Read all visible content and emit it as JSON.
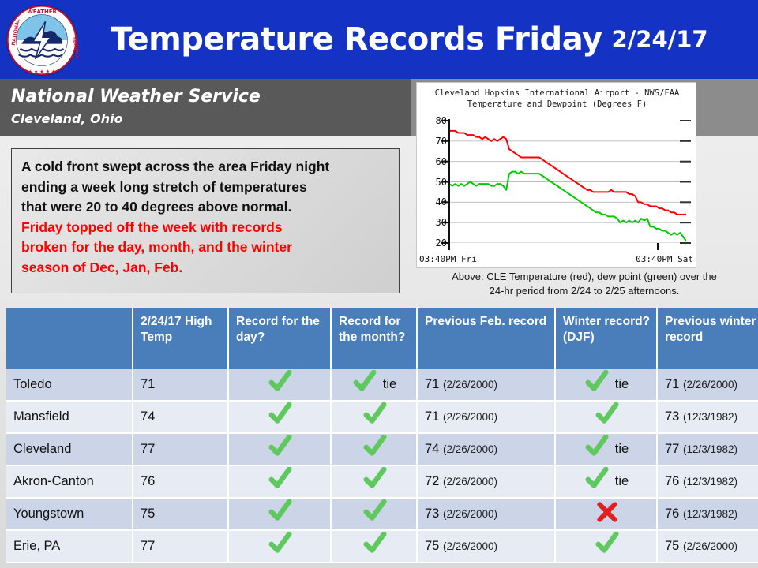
{
  "header": {
    "title": "Temperature Records Friday",
    "date": "2/24/17",
    "bg_color": "#1433c4",
    "logo_icon": "nws-seal-icon"
  },
  "office": {
    "name": "National Weather Service",
    "location": "Cleveland, Ohio",
    "bg_color": "#595959"
  },
  "summary": {
    "lines": [
      {
        "text": "A cold front swept across the area Friday night",
        "color": "#111111"
      },
      {
        "text": "ending a week long stretch of temperatures",
        "color": "#111111"
      },
      {
        "text": "that were 20 to 40 degrees above normal.",
        "color": "#111111"
      },
      {
        "text": "Friday topped off the week with records",
        "color": "#ff0000"
      },
      {
        "text": "broken for the day, month, and the winter",
        "color": "#ff0000"
      },
      {
        "text": "season of Dec, Jan, Feb.",
        "color": "#ff0000"
      }
    ]
  },
  "chart_data": {
    "type": "line",
    "title": "Cleveland Hopkins International Airport - NWS/FAA",
    "subtitle": "Temperature and Dewpoint (Degrees F)",
    "xlabel": "",
    "ylabel": "",
    "ylim": [
      20,
      80
    ],
    "yticks": [
      80,
      70,
      60,
      50,
      40,
      30,
      20
    ],
    "xticks": [
      "03:40PM Fri",
      "03:40PM Sat"
    ],
    "grid": true,
    "legend": "none",
    "series": [
      {
        "name": "Temperature",
        "color": "#ff0000",
        "values": [
          75,
          75,
          75,
          74,
          74,
          74,
          73,
          73,
          73,
          72,
          72,
          71,
          72,
          71,
          70,
          71,
          70,
          71,
          72,
          71,
          66,
          65,
          64,
          63,
          62,
          62,
          62,
          62,
          62,
          62,
          62,
          61,
          60,
          59,
          58,
          57,
          56,
          55,
          54,
          53,
          52,
          51,
          50,
          49,
          48,
          47,
          46,
          46,
          45,
          45,
          45,
          45,
          45,
          45,
          46,
          45,
          45,
          45,
          45,
          45,
          44,
          44,
          43,
          40,
          40,
          39,
          39,
          38,
          38,
          38,
          37,
          37,
          36,
          36,
          35,
          35,
          34,
          34,
          34,
          34
        ]
      },
      {
        "name": "Dewpoint",
        "color": "#00cc00",
        "values": [
          49,
          48,
          49,
          48,
          49,
          48,
          49,
          50,
          49,
          48,
          49,
          49,
          49,
          49,
          48,
          48,
          49,
          49,
          48,
          46,
          54,
          55,
          55,
          54,
          55,
          54,
          54,
          54,
          54,
          54,
          54,
          53,
          52,
          51,
          50,
          49,
          48,
          47,
          46,
          45,
          44,
          43,
          42,
          41,
          40,
          39,
          38,
          37,
          36,
          35,
          35,
          34,
          34,
          33,
          33,
          33,
          32,
          30,
          31,
          30,
          31,
          30,
          31,
          30,
          32,
          31,
          32,
          28,
          28,
          27,
          27,
          26,
          26,
          25,
          24,
          25,
          24,
          25,
          23,
          21
        ]
      }
    ]
  },
  "chart_caption": {
    "line1": "Above:  CLE Temperature  (red), dew point (green) over the",
    "line2": "24-hr period from 2/24 to 2/25 afternoons."
  },
  "table": {
    "header_bg": "#4a7ebb",
    "check_color": "#5fc85f",
    "x_color": "#e02020",
    "columns": [
      "",
      "2/24/17 High Temp",
      "Record for the day?",
      "Record for the month?",
      "Previous Feb. record",
      "Winter record? (DJF)",
      "Previous winter record"
    ],
    "rows": [
      {
        "city": "Toledo",
        "high_temp": "71",
        "record_day": "check",
        "record_month": "check",
        "record_month_note": "tie",
        "prev_feb_value": "71",
        "prev_feb_date": "(2/26/2000)",
        "winter_record": "check",
        "winter_note": "tie",
        "prev_winter_value": "71",
        "prev_winter_date": "(2/26/2000)"
      },
      {
        "city": "Mansfield",
        "high_temp": "74",
        "record_day": "check",
        "record_month": "check",
        "record_month_note": "",
        "prev_feb_value": "71",
        "prev_feb_date": "(2/26/2000)",
        "winter_record": "check",
        "winter_note": "",
        "prev_winter_value": "73",
        "prev_winter_date": "(12/3/1982)"
      },
      {
        "city": "Cleveland",
        "high_temp": "77",
        "record_day": "check",
        "record_month": "check",
        "record_month_note": "",
        "prev_feb_value": "74",
        "prev_feb_date": "(2/26/2000)",
        "winter_record": "check",
        "winter_note": "tie",
        "prev_winter_value": "77",
        "prev_winter_date": "(12/3/1982)"
      },
      {
        "city": "Akron-Canton",
        "high_temp": "76",
        "record_day": "check",
        "record_month": "check",
        "record_month_note": "",
        "prev_feb_value": "72",
        "prev_feb_date": "(2/26/2000)",
        "winter_record": "check",
        "winter_note": "tie",
        "prev_winter_value": "76",
        "prev_winter_date": "(12/3/1982)"
      },
      {
        "city": "Youngstown",
        "high_temp": "75",
        "record_day": "check",
        "record_month": "check",
        "record_month_note": "",
        "prev_feb_value": "73",
        "prev_feb_date": "(2/26/2000)",
        "winter_record": "x",
        "winter_note": "",
        "prev_winter_value": "76",
        "prev_winter_date": "(12/3/1982)"
      },
      {
        "city": "Erie, PA",
        "high_temp": "77",
        "record_day": "check",
        "record_month": "check",
        "record_month_note": "",
        "prev_feb_value": "75",
        "prev_feb_date": "(2/26/2000)",
        "winter_record": "check",
        "winter_note": "",
        "prev_winter_value": "75",
        "prev_winter_date": "(2/26/2000)"
      }
    ]
  }
}
